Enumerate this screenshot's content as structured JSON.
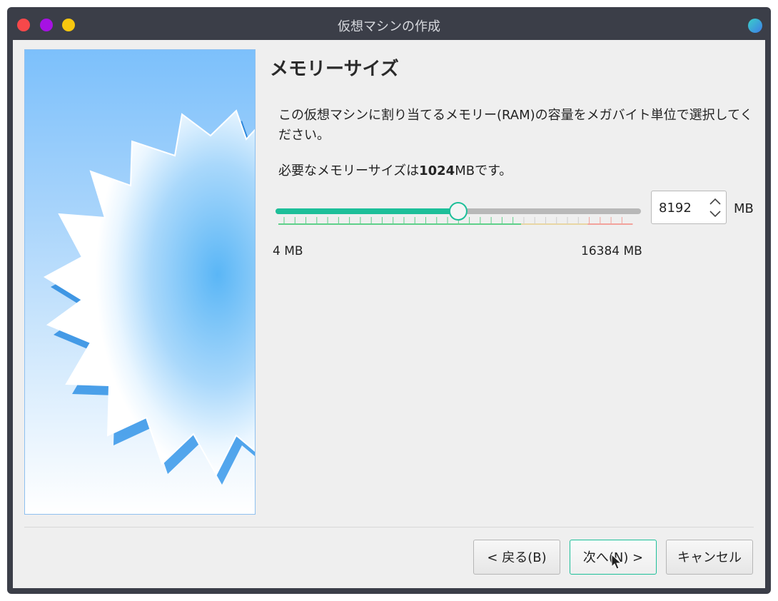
{
  "window": {
    "title": "仮想マシンの作成",
    "controls": [
      {
        "name": "close",
        "color": "#f7484a"
      },
      {
        "name": "minimize",
        "color": "#a612e3"
      },
      {
        "name": "maximize",
        "color": "#f7c70f"
      }
    ],
    "status_dot_colors": [
      "#3ad0c8",
      "#3e7de8"
    ]
  },
  "page": {
    "heading": "メモリーサイズ",
    "description": "この仮想マシンに割り当てるメモリー(RAM)の容量をメガバイト単位で選択してください。",
    "recommended_prefix": "必要なメモリーサイズは",
    "recommended_value": "1024",
    "recommended_suffix": "MBです。"
  },
  "memory": {
    "value": "8192",
    "value_number": 8192,
    "min": 4,
    "max": 16384,
    "unit": "MB",
    "min_label": "4 MB",
    "max_label": "16384 MB",
    "accent_color": "#1dbf99",
    "safe_color": "#5fd08a",
    "danger_color": "#f2a29c"
  },
  "buttons": {
    "back": "< 戻る(B)",
    "next": "次へ(N) >",
    "cancel": "キャンセル"
  }
}
